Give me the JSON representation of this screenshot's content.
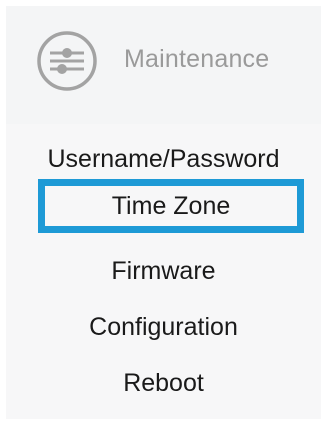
{
  "header": {
    "icon": "sliders-icon",
    "title": "Maintenance"
  },
  "menu": {
    "items": [
      {
        "label": "Username/Password",
        "selected": false
      },
      {
        "label": "Time Zone",
        "selected": true
      },
      {
        "label": "Firmware",
        "selected": false
      },
      {
        "label": "Configuration",
        "selected": false
      },
      {
        "label": "Reboot",
        "selected": false
      }
    ]
  },
  "colors": {
    "selection_border": "#1e9ad6",
    "header_text": "#9a9a9a",
    "menu_text": "#1a1a1a"
  }
}
